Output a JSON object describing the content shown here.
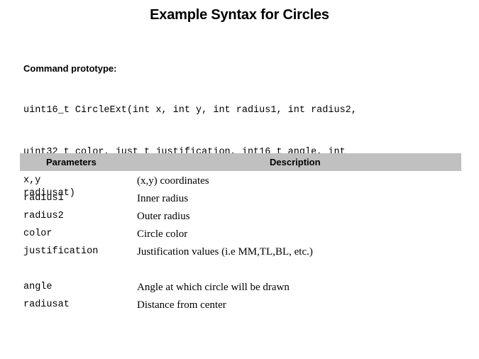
{
  "slide": {
    "title": "Example Syntax for Circles",
    "background_color": "#ffffff",
    "text_color": "#000000"
  },
  "prototype": {
    "label": "Command prototype:",
    "code_lines": [
      "uint16_t CircleExt(int x, int y, int radius1, int radius2,",
      "uint32_t color, just_t justification, int16_t angle, int",
      "radiusat)"
    ]
  },
  "table": {
    "header_background_color": "#c0c0c0",
    "columns": [
      {
        "key": "parameter",
        "label": "Parameters"
      },
      {
        "key": "description",
        "label": "Description"
      }
    ],
    "rows": [
      {
        "parameter": "x,y",
        "description": "(x,y) coordinates"
      },
      {
        "parameter": "radius1",
        "description": "Inner radius"
      },
      {
        "parameter": "radius2",
        "description": "Outer radius"
      },
      {
        "parameter": "color",
        "description": "Circle color"
      },
      {
        "parameter": "justification",
        "description": "Justification values (i.e MM,TL,BL, etc.)"
      },
      {
        "parameter": "",
        "description": ""
      },
      {
        "parameter": "angle",
        "description": "Angle at which circle will be drawn"
      },
      {
        "parameter": "radiusat",
        "description": "Distance from center"
      }
    ]
  }
}
